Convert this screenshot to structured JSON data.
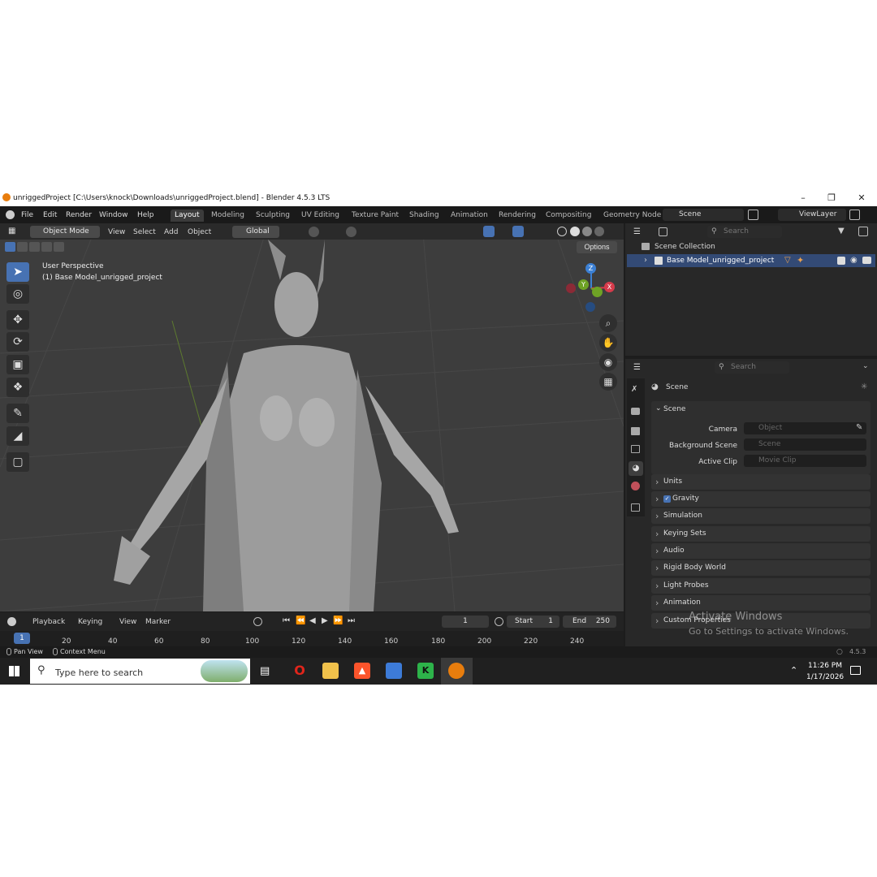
{
  "window": {
    "title": "unriggedProject [C:\\Users\\knock\\Downloads\\unriggedProject.blend] - Blender 4.5.3 LTS",
    "minimize": "–",
    "maximize": "❐",
    "close": "✕"
  },
  "menu": [
    "File",
    "Edit",
    "Render",
    "Window",
    "Help"
  ],
  "workspaces": [
    "Layout",
    "Modeling",
    "Sculpting",
    "UV Editing",
    "Texture Paint",
    "Shading",
    "Animation",
    "Rendering",
    "Compositing",
    "Geometry Node"
  ],
  "scene_field": "Scene",
  "viewlayer_field": "ViewLayer",
  "viewport": {
    "mode": "Object Mode",
    "menus": [
      "View",
      "Select",
      "Add",
      "Object"
    ],
    "transform": "Global",
    "options": "Options",
    "overlay_line1": "User Perspective",
    "overlay_line2": "(1) Base Model_unrigged_project",
    "gizmo": {
      "z": "Z",
      "y": "Y",
      "x": "X"
    }
  },
  "outliner": {
    "search_placeholder": "Search",
    "collection": "Scene Collection",
    "item": "Base Model_unrigged_project"
  },
  "properties": {
    "search_placeholder": "Search",
    "header": "Scene",
    "section": "Scene",
    "camera_label": "Camera",
    "camera_placeholder": "Object",
    "bg_label": "Background Scene",
    "bg_placeholder": "Scene",
    "clip_label": "Active Clip",
    "clip_placeholder": "Movie Clip",
    "panels": [
      "Units",
      "Gravity",
      "Simulation",
      "Keying Sets",
      "Audio",
      "Rigid Body World",
      "Light Probes",
      "Animation",
      "Custom Properties"
    ],
    "gravity_checked": true
  },
  "timeline": {
    "menus": [
      "Playback",
      "Keying",
      "View",
      "Marker"
    ],
    "current_frame": "1",
    "start_label": "Start",
    "start": "1",
    "end_label": "End",
    "end": "250",
    "ruler": [
      "1",
      "20",
      "40",
      "60",
      "80",
      "100",
      "120",
      "140",
      "160",
      "180",
      "200",
      "220",
      "240"
    ]
  },
  "status": {
    "left1": "Pan View",
    "left2": "Context Menu",
    "version": "4.5.3"
  },
  "activation": {
    "line1": "Activate Windows",
    "line2": "Go to Settings to activate Windows."
  },
  "taskbar": {
    "search_placeholder": "Type here to search",
    "time": "11:26 PM",
    "date": "1/17/2026"
  },
  "colors": {
    "accent": "#4772b3",
    "x_axis": "#d63b4b",
    "y_axis": "#6ea225",
    "z_axis": "#3c80d4"
  }
}
